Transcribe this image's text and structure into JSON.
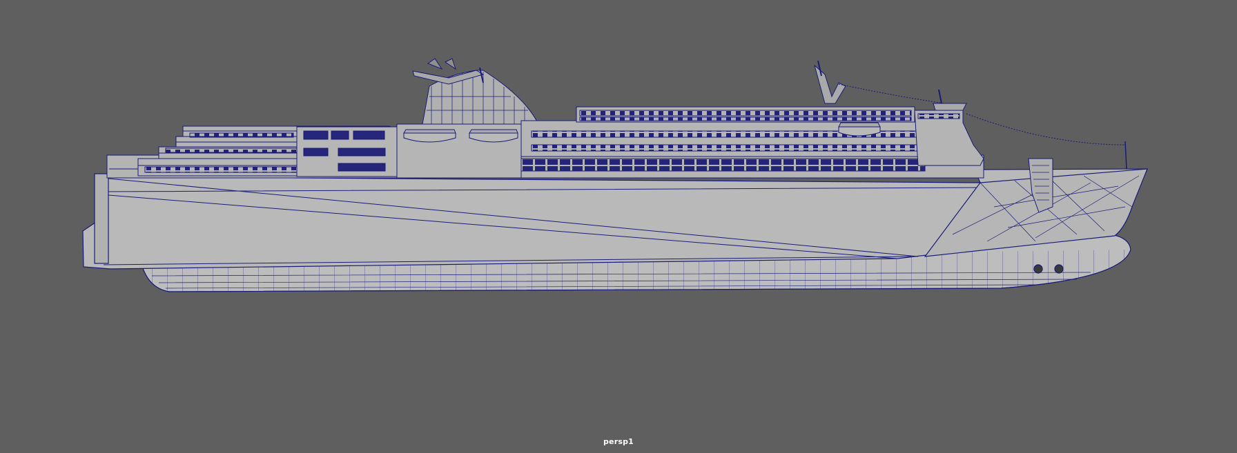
{
  "viewport": {
    "camera_name": "persp1",
    "background_color": "#5f5f5f",
    "model_fill_color": "#b9b9b9",
    "wire_color": "#1a1a78",
    "display_mode": "wireframe-on-shaded"
  },
  "model": {
    "object": "ferry-ship",
    "view": "side"
  }
}
